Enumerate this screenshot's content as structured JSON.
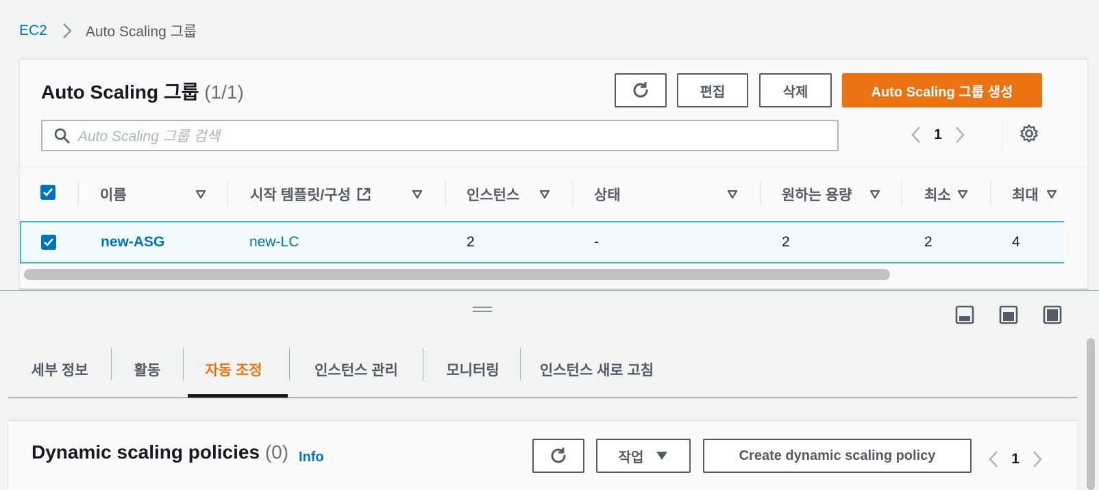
{
  "breadcrumb": {
    "root": "EC2",
    "current": "Auto Scaling 그룹"
  },
  "asg_panel": {
    "title": "Auto Scaling 그룹",
    "count": "(1/1)",
    "edit_label": "편집",
    "delete_label": "삭제",
    "create_label": "Auto Scaling 그룹 생성",
    "search_placeholder": "Auto Scaling 그룹 검색",
    "page": "1",
    "columns": [
      "이름",
      "시작 템플릿/구성",
      "인스턴스",
      "상태",
      "원하는 용량",
      "최소",
      "최대"
    ],
    "rows": [
      {
        "name": "new-ASG",
        "launch_config": "new-LC",
        "instances": "2",
        "status": "-",
        "desired": "2",
        "min": "2",
        "max": "4"
      }
    ]
  },
  "tabs": [
    {
      "label": "세부 정보"
    },
    {
      "label": "활동"
    },
    {
      "label": "자동 조정",
      "active": true
    },
    {
      "label": "인스턴스 관리"
    },
    {
      "label": "모니터링"
    },
    {
      "label": "인스턴스 새로 고침"
    }
  ],
  "policies_panel": {
    "title": "Dynamic scaling policies",
    "count": "(0)",
    "info_label": "Info",
    "actions_label": "작업",
    "create_label": "Create dynamic scaling policy",
    "page": "1"
  },
  "colors": {
    "primary": "#ec7211",
    "link": "#0073bb",
    "selected_row": "#f1faff",
    "selected_border": "#44b9d6"
  }
}
